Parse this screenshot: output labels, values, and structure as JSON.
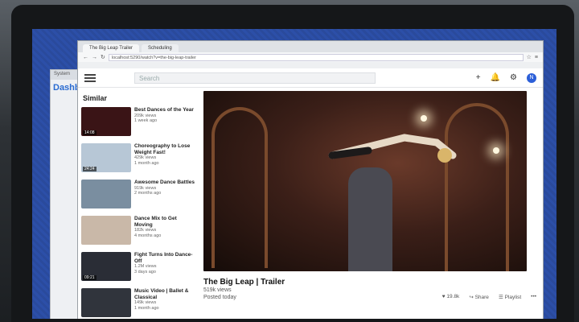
{
  "back_window": {
    "bar": "System",
    "title": "Dashb"
  },
  "tabs": [
    {
      "label": "The Big Leap Trailer",
      "active": true
    },
    {
      "label": "Scheduling",
      "active": false
    }
  ],
  "url": "localhost:5290/watch?v=the-big-leap-trailer",
  "app": {
    "search_placeholder": "Search",
    "avatar_letter": "N"
  },
  "sidebar": {
    "title": "Similar",
    "items": [
      {
        "title": "Best Dances of the Year",
        "views": "209k views",
        "age": "1 week ago",
        "duration": "14:08",
        "color": "#3a1416"
      },
      {
        "title": "Choreography to Lose Weight Fast!",
        "views": "429k views",
        "age": "1 month ago",
        "duration": "24:24",
        "color": "#b7c7d6"
      },
      {
        "title": "Awesome Dance Battles",
        "views": "919k views",
        "age": "2 months ago",
        "duration": "",
        "color": "#7a8ea0"
      },
      {
        "title": "Dance Mix to Get Moving",
        "views": "182k views",
        "age": "4 months ago",
        "duration": "",
        "color": "#c9b8a8"
      },
      {
        "title": "Fight Turns Into Dance-Off",
        "views": "1.2M views",
        "age": "3 days ago",
        "duration": "09:21",
        "color": "#2a2d36"
      },
      {
        "title": "Music Video | Ballet & Classical",
        "views": "149k views",
        "age": "1 month ago",
        "duration": "",
        "color": "#30343c"
      }
    ]
  },
  "video": {
    "title": "The Big Leap | Trailer",
    "views": "519k views",
    "posted": "Posted today",
    "likes": "19.8k",
    "share": "Share",
    "playlist": "Playlist"
  }
}
